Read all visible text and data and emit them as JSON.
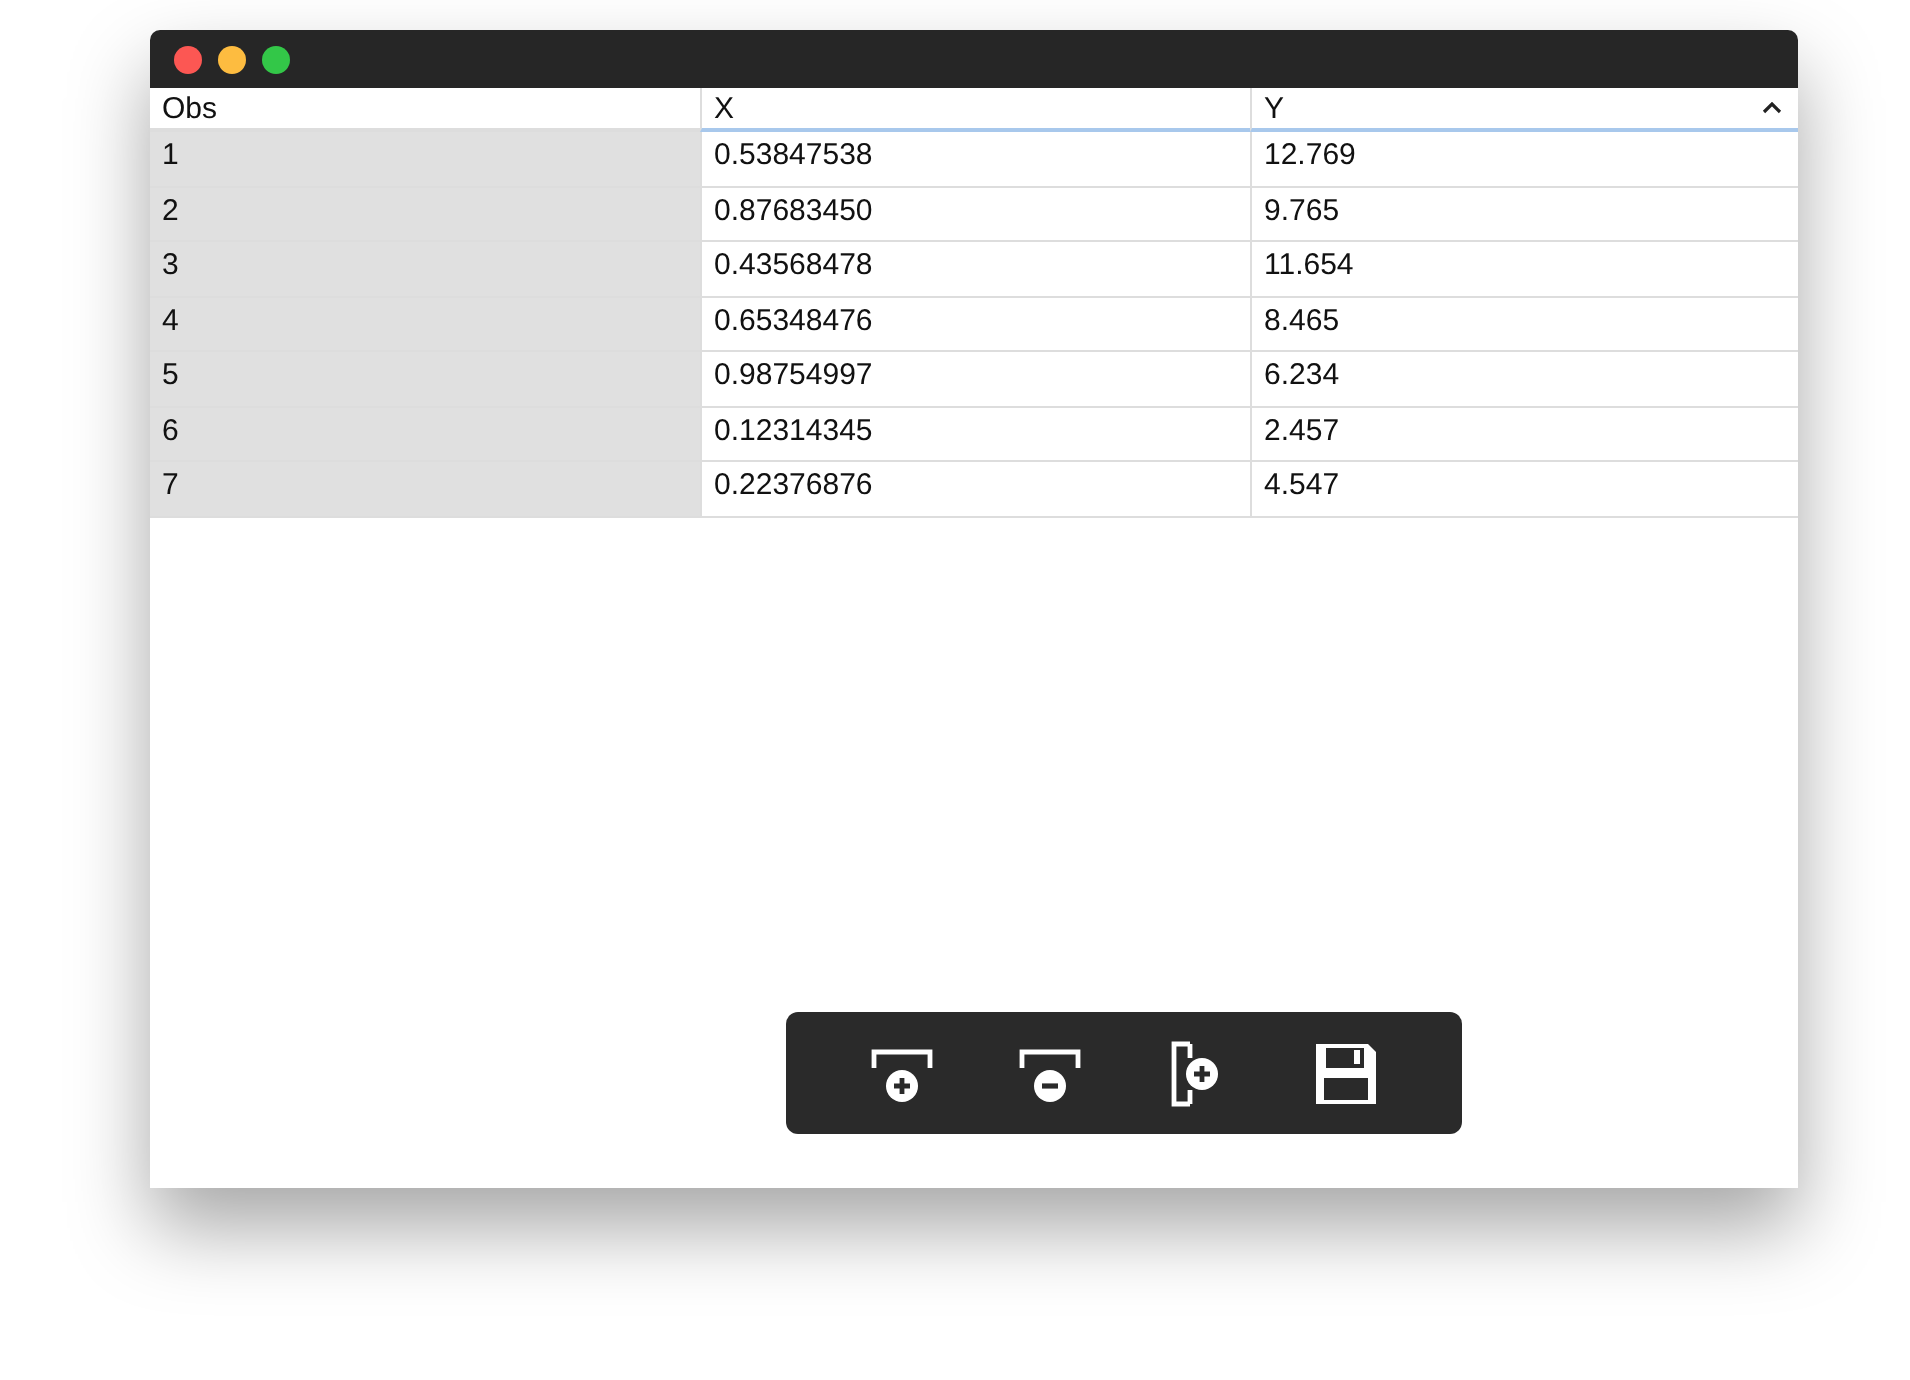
{
  "table": {
    "columns": [
      "Obs",
      "X",
      "Y"
    ],
    "rows": [
      [
        "1",
        "0.53847538",
        "12.769"
      ],
      [
        "2",
        "0.87683450",
        "9.765"
      ],
      [
        "3",
        "0.43568478",
        "11.654"
      ],
      [
        "4",
        "0.65348476",
        "8.465"
      ],
      [
        "5",
        "0.98754997",
        "6.234"
      ],
      [
        "6",
        "0.12314345",
        "2.457"
      ],
      [
        "7",
        "0.22376876",
        "4.547"
      ]
    ]
  },
  "toolbar": [
    {
      "kind": "add-row"
    },
    {
      "kind": "remove-row"
    },
    {
      "kind": "add-column"
    },
    {
      "kind": "save"
    }
  ]
}
